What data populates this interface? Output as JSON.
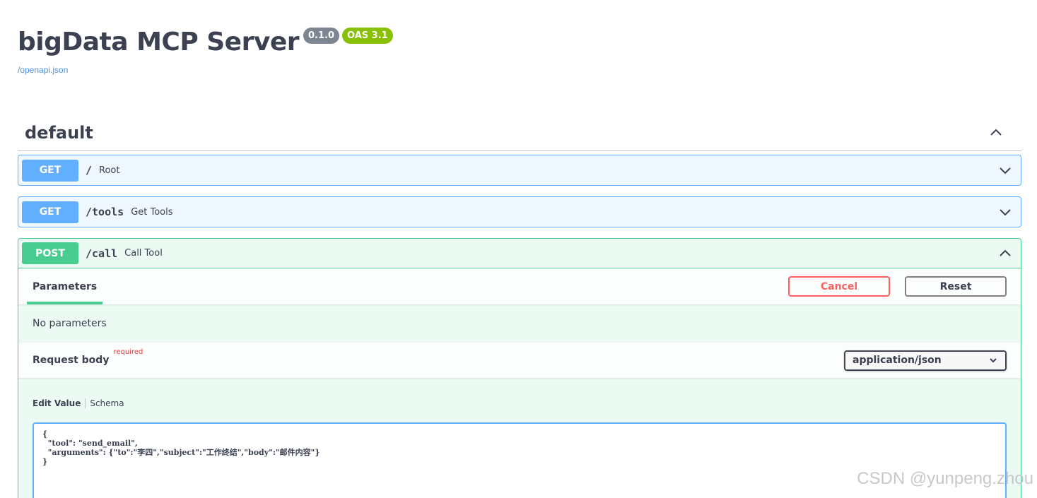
{
  "info": {
    "title": "bigData MCP Server",
    "version_badge": "0.1.0",
    "oas_badge": "OAS 3.1",
    "spec_link": "/openapi.json"
  },
  "tag": {
    "name": "default"
  },
  "operations": [
    {
      "method": "GET",
      "path": "/",
      "summary": "Root",
      "expanded": false
    },
    {
      "method": "GET",
      "path": "/tools",
      "summary": "Get Tools",
      "expanded": false
    },
    {
      "method": "POST",
      "path": "/call",
      "summary": "Call Tool",
      "expanded": true
    }
  ],
  "post_call": {
    "parameters_tab": "Parameters",
    "cancel_label": "Cancel",
    "reset_label": "Reset",
    "no_parameters": "No parameters",
    "request_body_label": "Request body",
    "required_label": "required",
    "content_type": "application/json",
    "edit_value_tab": "Edit Value",
    "schema_tab": "Schema",
    "body_value": "{\n  \"tool\": \"send_email\",\n  \"arguments\": {\"to\":\"李四\",\"subject\":\"工作终结\",\"body\":\"邮件内容\"}\n}"
  },
  "watermark": "CSDN @yunpeng.zhou",
  "icons": {
    "chevron_up": "chevron-up-icon",
    "chevron_down": "chevron-down-icon"
  },
  "colors": {
    "get": "#61affe",
    "post": "#49cc90",
    "cancel": "#ff6060",
    "version_badge": "#7d8492",
    "oas_badge": "#89bf04"
  }
}
